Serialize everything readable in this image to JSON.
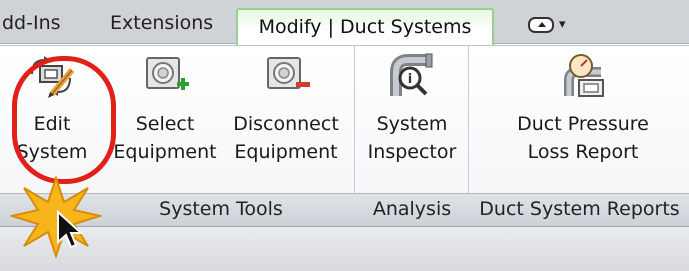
{
  "tabs": [
    {
      "label": "dd-Ins"
    },
    {
      "label": "Extensions"
    },
    {
      "label": "Modify | Duct Systems",
      "active": true
    }
  ],
  "tab_extra_icon": "panel-toggle-icon",
  "ribbon": {
    "buttons": [
      {
        "line1": "Edit",
        "line2": "System",
        "icon": "edit-system-icon"
      },
      {
        "line1": "Select",
        "line2": "Equipment",
        "icon": "select-equipment-icon"
      },
      {
        "line1": "Disconnect",
        "line2": "Equipment",
        "icon": "disconnect-equipment-icon"
      },
      {
        "line1": "System",
        "line2": "Inspector",
        "icon": "system-inspector-icon"
      },
      {
        "line1": "Duct Pressure",
        "line2": "Loss Report",
        "icon": "pressure-loss-report-icon"
      }
    ],
    "panels": [
      {
        "title": "System Tools"
      },
      {
        "title": "Analysis"
      },
      {
        "title": "Duct System Reports"
      }
    ]
  },
  "colors": {
    "active_tab_border": "#97d08e",
    "highlight": "#e2201a",
    "burst": "#f7b51c",
    "add_green": "#2e9e2e",
    "remove_red": "#d53a2c"
  }
}
